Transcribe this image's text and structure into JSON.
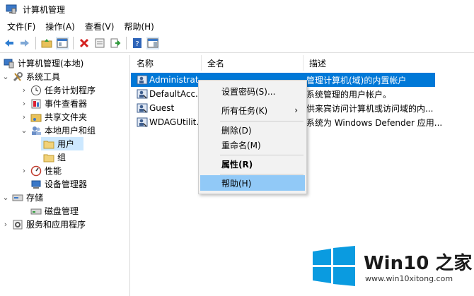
{
  "window": {
    "title": "计算机管理"
  },
  "menubar": {
    "items": [
      "文件(F)",
      "操作(A)",
      "查看(V)",
      "帮助(H)"
    ]
  },
  "toolbar": {
    "icons": [
      "back-arrow-icon",
      "forward-arrow-icon",
      "up-folder-icon",
      "show-pane-icon",
      "delete-icon",
      "properties-icon",
      "export-icon",
      "help-icon",
      "action-pane-icon"
    ]
  },
  "tree": {
    "root": "计算机管理(本地)",
    "system_tools": "系统工具",
    "task_scheduler": "任务计划程序",
    "event_viewer": "事件查看器",
    "shared_folders": "共享文件夹",
    "local_users": "本地用户和组",
    "users": "用户",
    "groups": "组",
    "performance": "性能",
    "device_manager": "设备管理器",
    "storage": "存储",
    "disk_management": "磁盘管理",
    "services_apps": "服务和应用程序"
  },
  "list": {
    "headers": {
      "name": "名称",
      "fullname": "全名",
      "description": "描述"
    },
    "rows": [
      {
        "name": "Administrat...",
        "fullname": "",
        "description": "管理计算机(域)的内置帐户"
      },
      {
        "name": "DefaultAcc...",
        "fullname": "",
        "description": "系统管理的用户帐户。"
      },
      {
        "name": "Guest",
        "fullname": "",
        "description": "供来宾访问计算机或访问域的内..."
      },
      {
        "name": "WDAGUtilit...",
        "fullname": "",
        "description": "系统为 Windows Defender 应用..."
      }
    ]
  },
  "context_menu": {
    "set_password": "设置密码(S)...",
    "all_tasks": "所有任务(K)",
    "all_tasks_arrow": "›",
    "delete": "删除(D)",
    "rename": "重命名(M)",
    "properties": "属性(R)",
    "help": "帮助(H)"
  },
  "watermark": {
    "brand": "Win10 之家",
    "url": "www.win10xitong.com"
  },
  "colors": {
    "selection": "#0078d7",
    "menu_highlight": "#91c9f7",
    "tree_selected": "#cce8ff",
    "windows_logo": "#0a9be0"
  }
}
